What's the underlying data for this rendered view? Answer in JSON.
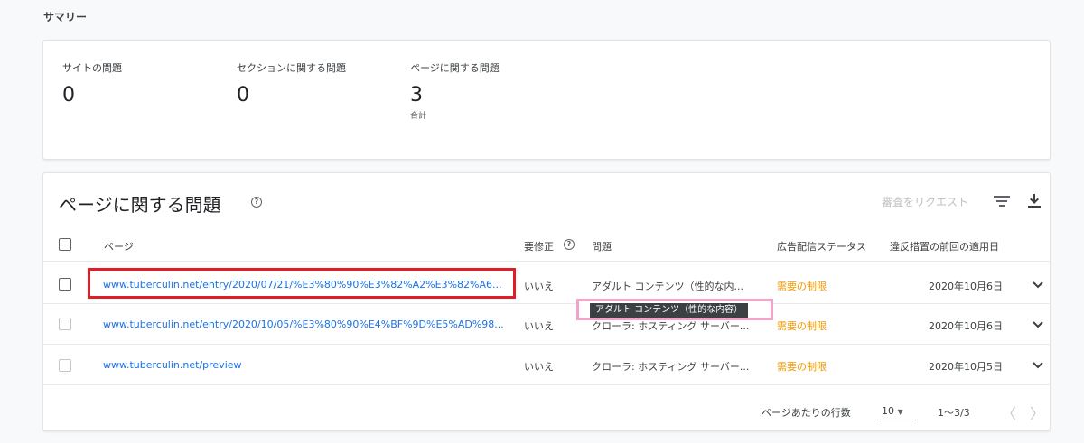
{
  "summary": {
    "heading": "サマリー",
    "stats": [
      {
        "label": "サイトの問題",
        "value": "0",
        "sub": ""
      },
      {
        "label": "セクションに関する問題",
        "value": "0",
        "sub": ""
      },
      {
        "label": "ページに関する問題",
        "value": "3",
        "sub": "合計"
      }
    ]
  },
  "issues": {
    "title": "ページに関する問題",
    "help_icon": "help-circle-icon",
    "review_label": "審査をリクエスト",
    "filter_icon": "filter-icon",
    "download_icon": "download-icon",
    "columns": {
      "page": "ページ",
      "needs_fix": "要修正",
      "issue": "問題",
      "ad_status": "広告配信ステータス",
      "last_enforced": "違反措置の前回の適用日"
    },
    "rows": [
      {
        "url": "www.tuberculin.net/entry/2020/07/21/%E3%80%90%E3%82%A2%E3%82%A6...",
        "needs_fix": "いいえ",
        "issue": "アダルト コンテンツ（性的な内...",
        "ad_status": "需要の制限",
        "date": "2020年10月6日"
      },
      {
        "url": "www.tuberculin.net/entry/2020/10/05/%E3%80%90%E4%BF%9D%E5%AD%98...",
        "needs_fix": "いいえ",
        "issue": "クローラ: ホスティング サーバー...",
        "ad_status": "需要の制限",
        "date": "2020年10月6日"
      },
      {
        "url": "www.tuberculin.net/preview",
        "needs_fix": "いいえ",
        "issue": "クローラ: ホスティング サーバー...",
        "ad_status": "需要の制限",
        "date": "2020年10月5日"
      }
    ],
    "tooltip": "アダルト コンテンツ（性的な内容）",
    "pagination": {
      "rows_per_page_label": "ページあたりの行数",
      "rows_per_page_value": "10",
      "range": "1〜3/3",
      "prev": "〈",
      "next": "〉"
    }
  },
  "colors": {
    "link": "#1a73e8",
    "status_warning": "#f29900",
    "highlight_red": "#e01c24",
    "highlight_pink": "#f2a3c7"
  }
}
